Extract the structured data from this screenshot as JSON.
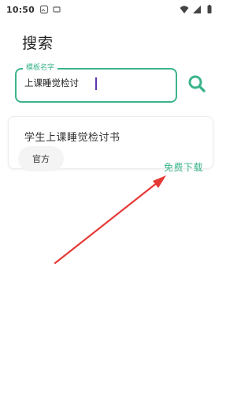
{
  "status_bar": {
    "time": "10:50"
  },
  "header": {
    "title": "搜索"
  },
  "search": {
    "legend": "模板名字",
    "value": "上课睡觉检讨"
  },
  "result": {
    "title": "学生上课睡觉检讨书",
    "tag": "官方",
    "action": "免费下载"
  },
  "colors": {
    "accent": "#3bb48d",
    "arrow": "#e53935"
  },
  "icons": [
    "image-icon",
    "sim-icon",
    "wifi-icon",
    "signal-icon",
    "battery-icon",
    "search-icon"
  ]
}
